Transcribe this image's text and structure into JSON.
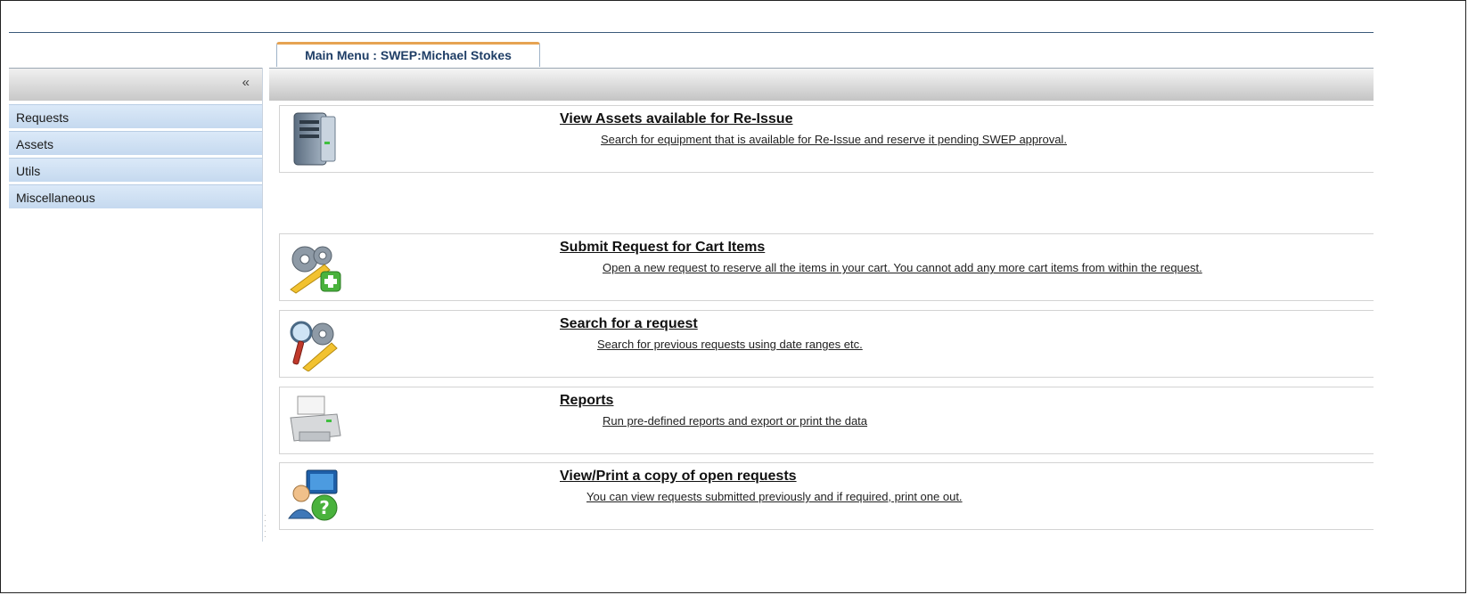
{
  "tab": {
    "label": "Main Menu : SWEP:Michael Stokes"
  },
  "sidebar": {
    "collapse_label": "«",
    "items": [
      {
        "label": "Requests"
      },
      {
        "label": "Assets"
      },
      {
        "label": "Utils"
      },
      {
        "label": "Miscellaneous"
      }
    ]
  },
  "menu": {
    "items": [
      {
        "title": "View Assets available for Re-Issue",
        "description": "Search for equipment that is available for Re-Issue and reserve it pending SWEP approval.",
        "icon": "server-icon"
      },
      {
        "title": "Submit Request for Cart Items",
        "description": "Open a new request to reserve all the items in your cart. You cannot add any more cart items from within the request.",
        "icon": "gears-add-icon"
      },
      {
        "title": "Search for a request",
        "description": "Search for previous requests using date ranges etc.",
        "icon": "search-tools-icon"
      },
      {
        "title": "Reports",
        "description": "Run pre-defined reports and export or print the data",
        "icon": "printer-icon"
      },
      {
        "title": "View/Print a copy of open requests",
        "description": "You can view requests submitted previously and if required, print one out.",
        "icon": "user-help-icon"
      }
    ]
  }
}
